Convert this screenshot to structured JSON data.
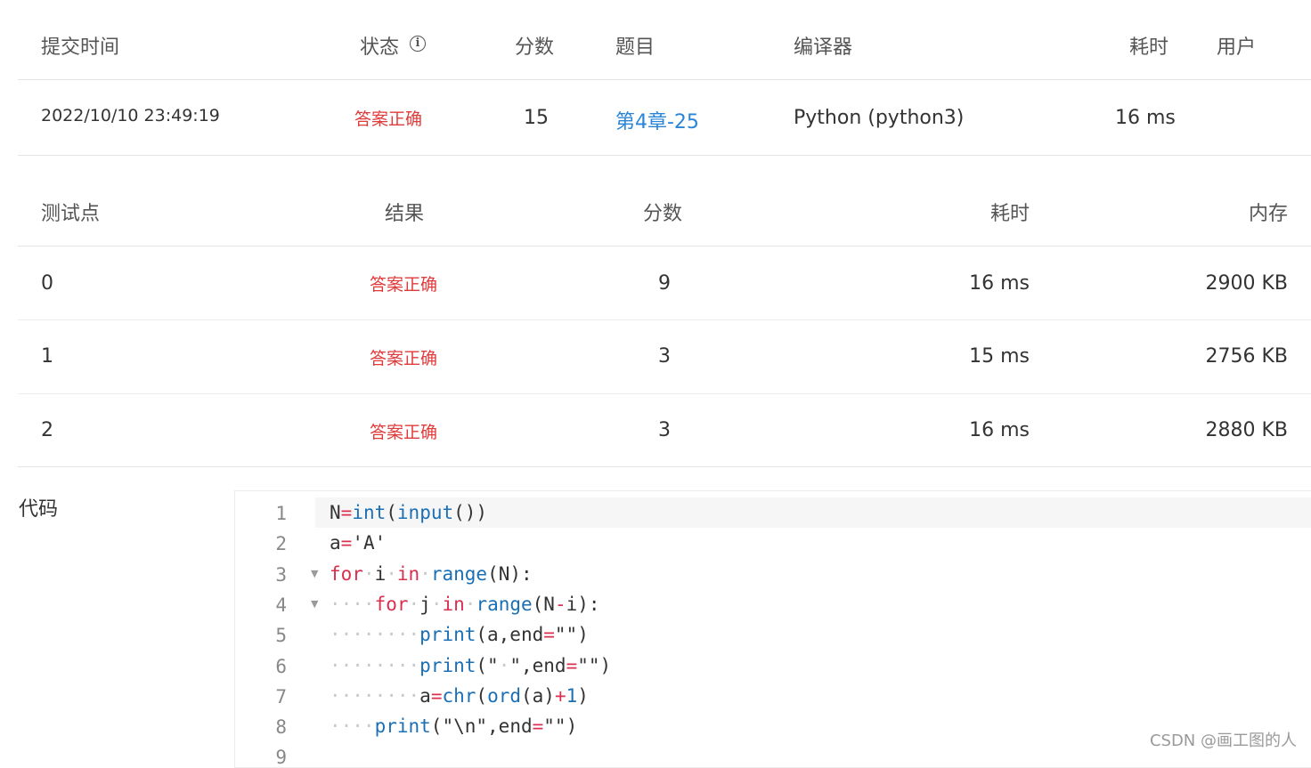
{
  "submission": {
    "headers": {
      "time": "提交时间",
      "status": "状态",
      "score": "分数",
      "problem": "题目",
      "compiler": "编译器",
      "elapsed": "耗时",
      "user": "用户"
    },
    "row": {
      "time": "2022/10/10 23:49:19",
      "status": "答案正确",
      "score": "15",
      "problem": "第4章-25",
      "compiler": "Python (python3)",
      "elapsed": "16 ms",
      "user": ""
    }
  },
  "testcases": {
    "headers": {
      "point": "测试点",
      "result": "结果",
      "score": "分数",
      "elapsed": "耗时",
      "memory": "内存"
    },
    "rows": [
      {
        "point": "0",
        "result": "答案正确",
        "score": "9",
        "elapsed": "16 ms",
        "memory": "2900 KB"
      },
      {
        "point": "1",
        "result": "答案正确",
        "score": "3",
        "elapsed": "15 ms",
        "memory": "2756 KB"
      },
      {
        "point": "2",
        "result": "答案正确",
        "score": "3",
        "elapsed": "16 ms",
        "memory": "2880 KB"
      }
    ]
  },
  "code_section": {
    "label": "代码",
    "line_numbers": [
      "1",
      "2",
      "3",
      "4",
      "5",
      "6",
      "7",
      "8",
      "9"
    ],
    "lines": [
      "N=int(input())",
      "a='A'",
      "for i in range(N):",
      "    for j in range(N-i):",
      "        print(a,end=\"\")",
      "        print(\" \",end=\"\")",
      "        a=chr(ord(a)+1)",
      "    print(\"\\n\",end=\"\")",
      ""
    ]
  },
  "watermark": "CSDN @画工图的人",
  "colors": {
    "accepted": "#e03a3a",
    "link": "#2a85d8",
    "keyword": "#d9304f",
    "builtin": "#1a6fb5"
  },
  "icons": {
    "status_info": "info-circle-icon",
    "fold": "fold-arrow-icon"
  }
}
